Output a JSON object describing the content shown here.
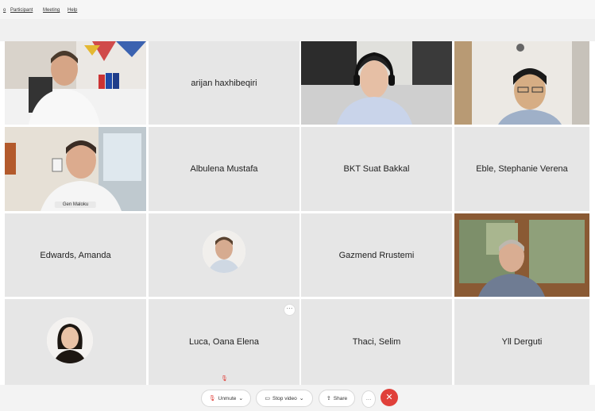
{
  "menu": {
    "items": [
      "o",
      "Participant",
      "Meeting",
      "Help"
    ]
  },
  "participants": {
    "p1": {
      "name": ""
    },
    "p2": {
      "name": "arijan haxhibeqiri"
    },
    "p3": {
      "name": ""
    },
    "p4": {
      "name": ""
    },
    "p5": {
      "name": "Gen Maloku"
    },
    "p6": {
      "name": "Albulena Mustafa"
    },
    "p7": {
      "name": "BKT Suat Bakkal"
    },
    "p8": {
      "name": "Eble, Stephanie Verena"
    },
    "p9": {
      "name": "Edwards, Amanda"
    },
    "p10": {
      "name": ""
    },
    "p11": {
      "name": "Gazmend Rrustemi"
    },
    "p12": {
      "name": ""
    },
    "p13": {
      "name": ""
    },
    "p14": {
      "name": "Luca, Oana Elena"
    },
    "p15": {
      "name": "Thaci, Selim"
    },
    "p16": {
      "name": "Yll Derguti"
    }
  },
  "toolbar": {
    "unmute_label": "Unmute",
    "stop_video_label": "Stop video",
    "share_label": "Share",
    "more_label": "···",
    "end_label": "✕"
  },
  "colors": {
    "active_speaker": "#29a8e0",
    "end_call": "#e0403a"
  },
  "icons": [
    "microphone-muted-icon",
    "video-camera-icon",
    "share-icon",
    "more-icon",
    "end-call-icon",
    "chevron-down-icon"
  ]
}
